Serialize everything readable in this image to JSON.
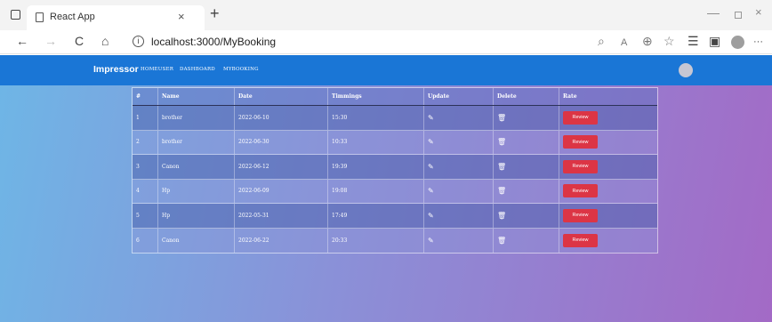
{
  "browser": {
    "tab_title": "React App",
    "tab_close": "×",
    "new_tab": "+",
    "url": "localhost:3000/MyBooking",
    "window_min": "—",
    "window_close": "×",
    "icons": {
      "back": "←",
      "forward": "→",
      "reload": "C",
      "home": "⌂",
      "info": "i",
      "search": "⌕",
      "read_aloud": "A",
      "zoom": "⊕",
      "favorite": "☆",
      "favorites": "☰",
      "collections": "▣",
      "more": "···"
    }
  },
  "navbar": {
    "brand": "Impressor",
    "links": [
      "HOMEUSER",
      "DASHBOARD",
      "MYBOOKING"
    ]
  },
  "table": {
    "headers": [
      "#",
      "Name",
      "Date",
      "Timmings",
      "Update",
      "Delete",
      "Rate"
    ],
    "rows": [
      {
        "num": "1",
        "name": "brother",
        "date": "2022-06-10",
        "time": "15:30",
        "review": "Review"
      },
      {
        "num": "2",
        "name": "brother",
        "date": "2022-06-30",
        "time": "10:33",
        "review": "Review"
      },
      {
        "num": "3",
        "name": "Canon",
        "date": "2022-06-12",
        "time": "19:39",
        "review": "Review"
      },
      {
        "num": "4",
        "name": "Hp",
        "date": "2022-06-09",
        "time": "19:08",
        "review": "Review"
      },
      {
        "num": "5",
        "name": "Hp",
        "date": "2022-05-31",
        "time": "17:49",
        "review": "Review"
      },
      {
        "num": "6",
        "name": "Canon",
        "date": "2022-06-22",
        "time": "20:33",
        "review": "Review"
      }
    ],
    "edit_icon": "✎",
    "delete_icon": "🗑"
  },
  "colors": {
    "navbar": "#1a76d6",
    "review_button": "#dc3545",
    "gradient_start": "#6eb6e6",
    "gradient_end": "#a36ac6"
  }
}
